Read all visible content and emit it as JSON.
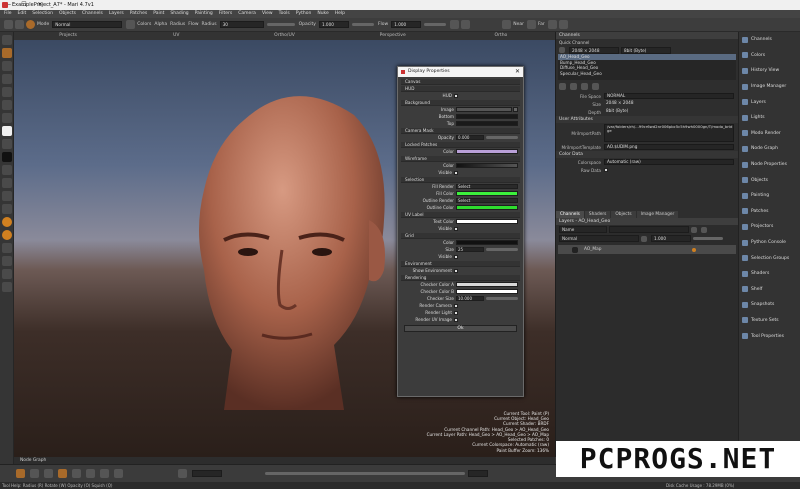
{
  "window": {
    "title": "ExampleProject_A7* - Mari 4.7v1",
    "minimize": "—",
    "maximize": "☐",
    "close": "✕"
  },
  "menu": [
    "File",
    "Edit",
    "Selection",
    "Objects",
    "Channels",
    "Layers",
    "Patches",
    "Paint",
    "Shading",
    "Painting",
    "Filters",
    "Camera",
    "View",
    "Tools",
    "Python",
    "Nuke",
    "Help"
  ],
  "toolbar": {
    "mode_label": "Mode",
    "mode_value": "Normal",
    "colors_label": "Colors",
    "alpha_label": "Alpha",
    "radius_label": "Radius",
    "flow_label": "Flow",
    "radius2_label": "Radius",
    "radius_value": "30",
    "opacity_label": "Opacity",
    "opacity_value": "1.000",
    "flow2_label": "Flow",
    "flow_value": "1.000",
    "near_label": "Near",
    "far_label": "Far"
  },
  "viewport": {
    "tabs": [
      "Projects",
      "UV",
      "Ortho/UV",
      "Perspective",
      "Ortho"
    ],
    "hud": [
      "Current Tool: Paint (P)",
      "Current Object: Head_Geo",
      "Current Shader: BRDF",
      "Current Channel Path: Head_Geo > AO_Head_Geo",
      "Current Layer Path: Head_Geo > AO_Head_Geo > AO_Map",
      "Selected Patches: 0",
      "Current Colorspace: Automatic (raw)",
      "Paint Buffer Zoom: 136%"
    ]
  },
  "dialog": {
    "title": "Display Properties",
    "close": "✕",
    "canvas_tab": "Canvas",
    "sections": {
      "hud": "HUD",
      "hud_row": "HUD",
      "background": "Background",
      "image": "Image",
      "bottom": "Bottom",
      "top": "Top",
      "camera_mask": "Camera Mask",
      "opacity": "Opacity",
      "opacity_value": "0.000",
      "locked_patches": "Locked Patches",
      "color": "Color",
      "wireframe": "Wireframe",
      "wf_color": "Color",
      "wf_visible": "Visible",
      "selection": "Selection",
      "fill_render": "Fill Render",
      "fill_render_value": "Select",
      "fill_color": "Fill Color",
      "outline_render": "Outline Render",
      "outline_render_value": "Select",
      "outline_color": "Outline Color",
      "uv_label": "UV Label",
      "text_color": "Text Color",
      "uv_visible": "Visible",
      "grid": "Grid",
      "grid_color": "Color",
      "grid_size": "Size",
      "grid_size_value": "25",
      "grid_visible": "Visible",
      "environment": "Environment",
      "show_environment": "Show Environment",
      "rendering": "Rendering",
      "checker_a": "Checker Color A",
      "checker_b": "Checker Color B",
      "checker_size": "Checker Size",
      "checker_size_value": "10.000",
      "render_camera": "Render Camera",
      "render_light": "Render Light",
      "render_uv_image": "Render UV Image"
    },
    "ok": "Ok",
    "colors": {
      "locked": "#b9a0d8",
      "fill": "#3cf03c",
      "outline": "#2edc2e",
      "text": "#ffffff",
      "grid": "#111111",
      "checker_a": "#d8d8d8",
      "checker_b": "#ffffff"
    }
  },
  "channels_panel": {
    "title": "Channels",
    "quick_channel_label": "Quick Channel",
    "size_value": "2048 × 2048",
    "depth_value": "8bit (Byte)",
    "items": [
      "AO_Head_Geo",
      "Bump_Head_Geo",
      "Diffuse_Head_Geo",
      "Specular_Head_Geo"
    ],
    "file_space_label": "File Space",
    "file_space_value": "NORMAL",
    "size_label": "Size",
    "size_row_value": "2048 × 2048",
    "depth_label": "Depth",
    "depth_row_value": "8bit (Byte)",
    "user_attributes": "User Attributes",
    "mri_path_label": "MriImportPath",
    "mri_path_value": "/var/folders/rh/...99cr6wd2nr006pbc5c5h9wh0000gn/T/modo_bridge",
    "mri_template_label": "MriImportTemplate",
    "mri_template_value": "AO.$UDIM.png",
    "color_data": "Color Data",
    "colorspace_label": "Colorspace",
    "colorspace_value": "Automatic (raw)",
    "rawdata_label": "Raw Data",
    "tabs": [
      "Channels",
      "Shaders",
      "Objects",
      "Image Manager"
    ]
  },
  "layers_panel": {
    "title": "Layers - AO_Head_Geo",
    "filter_value": "Name",
    "blend_value": "Normal",
    "opacity_value": "1.000",
    "layer": "AO_Map",
    "tabs": [
      "Shelf",
      "Layers - AO_Head_Geo",
      "Node Properties"
    ]
  },
  "shelf": [
    "Channels",
    "Colors",
    "History View",
    "Image Manager",
    "Layers",
    "Lights",
    "Modo Render",
    "Node Graph",
    "Node Properties",
    "Objects",
    "Painting",
    "Patches",
    "Projectors",
    "Python Console",
    "Selection Groups",
    "Shaders",
    "Shelf",
    "Snapshots",
    "Texture Sets",
    "Tool Properties"
  ],
  "node_graph_label": "Node Graph",
  "status": {
    "help": "Tool Help:  Radius (R)  Rotate (W)  Opacity (O)  Squish (Q)",
    "cache": "Disk Cache Usage : 78.29MB (0%)"
  },
  "watermark": "PCPROGS.NET"
}
